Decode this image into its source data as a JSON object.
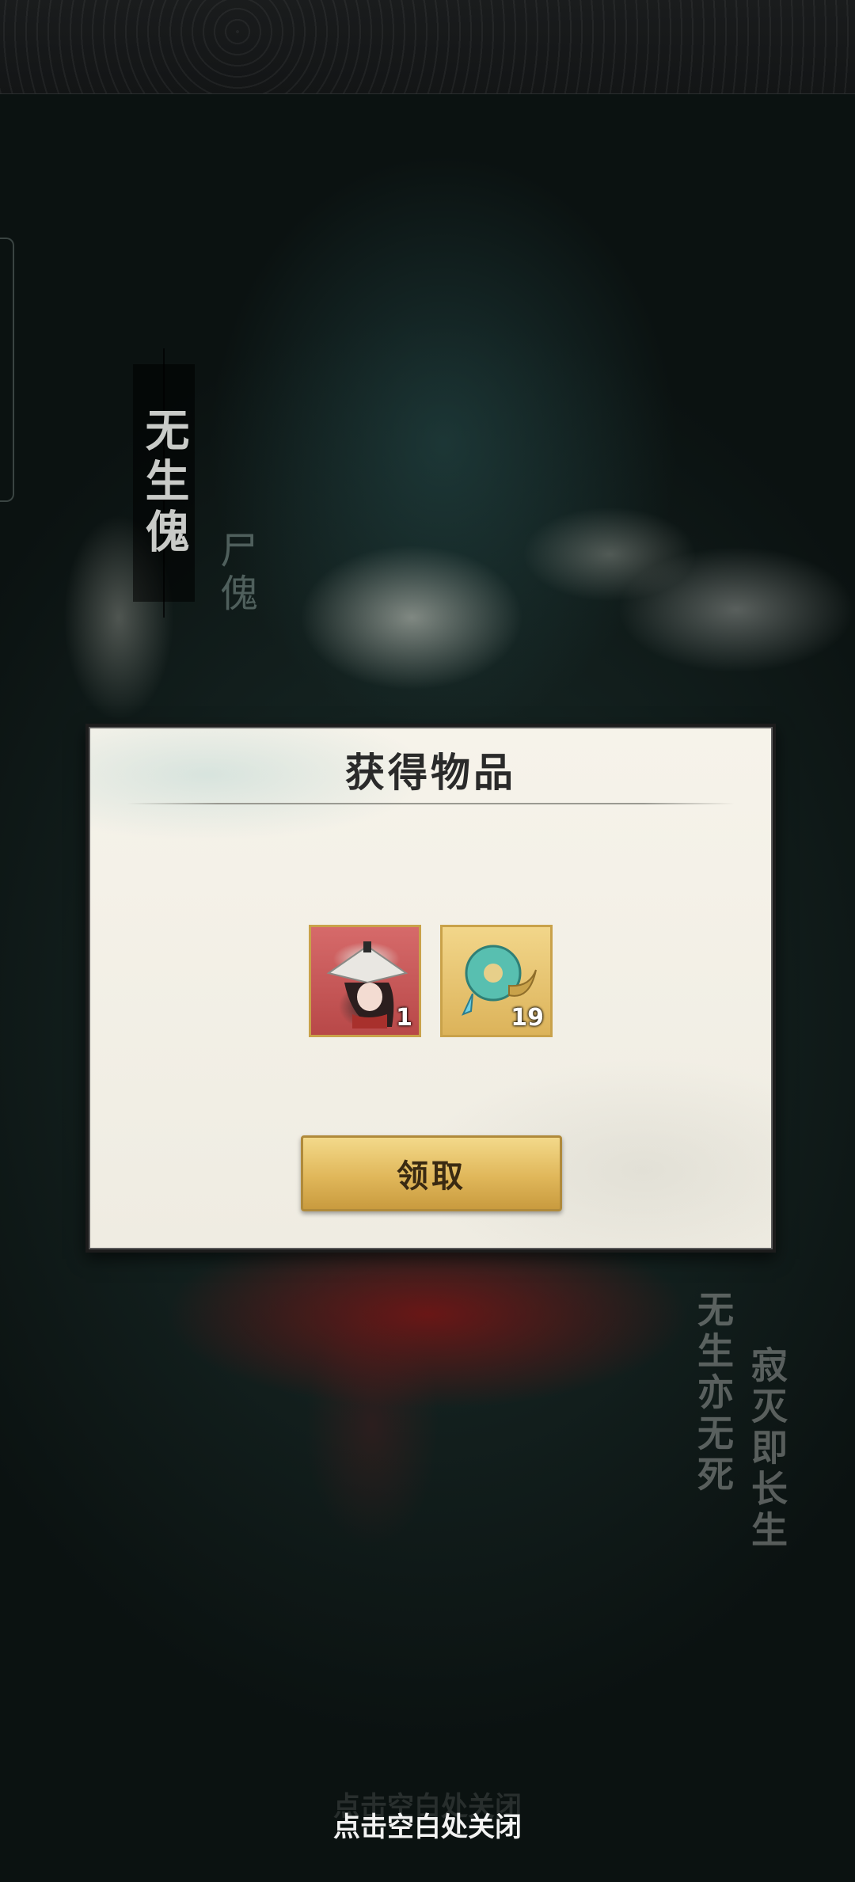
{
  "background": {
    "side_title": "无生傀",
    "side_subtitle": "尸傀",
    "poem_line_1": "无生亦无死",
    "poem_line_2": "寂灭即长生"
  },
  "dialog": {
    "title": "获得物品",
    "items": [
      {
        "icon": "character-portrait-icon",
        "count": "1"
      },
      {
        "icon": "jade-pendant-icon",
        "count": "19"
      }
    ],
    "claim_label": "领取"
  },
  "footer": {
    "close_hint": "点击空白处关闭"
  },
  "colors": {
    "button_gold": "#e0b75a",
    "dialog_paper": "#f6f3ea",
    "item_frame": "#c9a24a"
  }
}
